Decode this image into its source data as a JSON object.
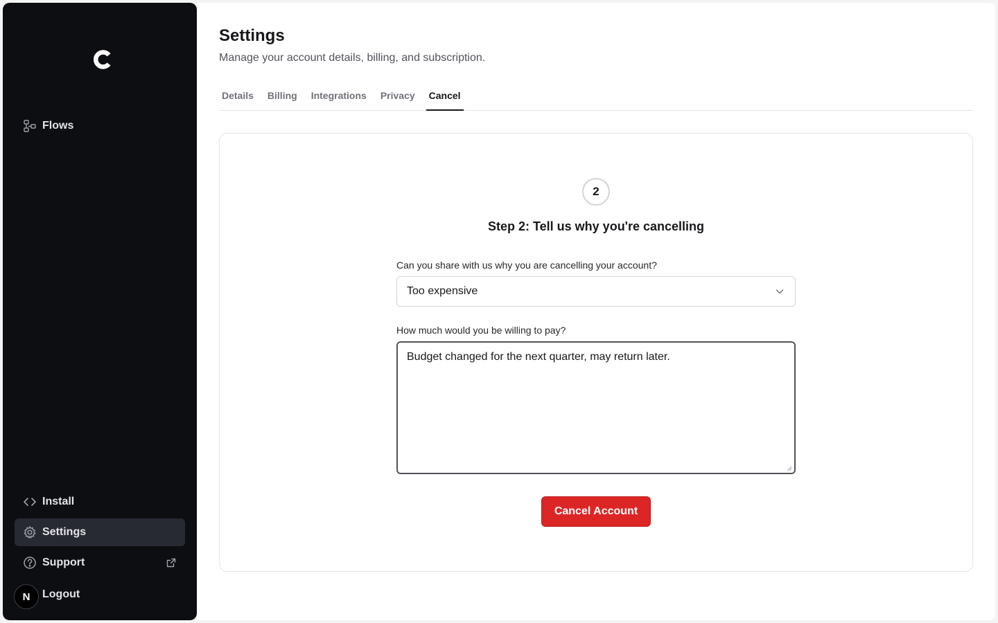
{
  "sidebar": {
    "logo_letter": "C",
    "top_items": [
      {
        "label": "Flows",
        "icon": "flows-icon"
      }
    ],
    "bottom_items": [
      {
        "label": "Install",
        "icon": "code-icon"
      },
      {
        "label": "Settings",
        "icon": "gear-icon",
        "active": true
      },
      {
        "label": "Support",
        "icon": "help-circle-icon",
        "external": true
      }
    ],
    "avatar_initial": "N",
    "logout_label": "Logout"
  },
  "header": {
    "title": "Settings",
    "subtitle": "Manage your account details, billing, and subscription."
  },
  "tabs": [
    {
      "label": "Details"
    },
    {
      "label": "Billing"
    },
    {
      "label": "Integrations"
    },
    {
      "label": "Privacy"
    },
    {
      "label": "Cancel",
      "active": true
    }
  ],
  "cancel_form": {
    "step_number": "2",
    "step_title": "Step 2: Tell us why you're cancelling",
    "reason_label": "Can you share with us why you are cancelling your account?",
    "reason_value": "Too expensive",
    "pay_label": "How much would you be willing to pay?",
    "pay_value": "Budget changed for the next quarter, may return later.",
    "submit_label": "Cancel Account"
  },
  "colors": {
    "sidebar_bg": "#0d0e12",
    "active_item_bg": "#272a33",
    "danger": "#dc2626"
  }
}
